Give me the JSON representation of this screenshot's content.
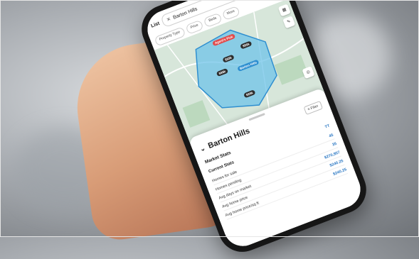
{
  "app": {
    "search": {
      "list_label": "List",
      "query": "Barton Hills"
    },
    "filters": [
      "Property Type",
      "Price",
      "Beds",
      "More"
    ],
    "map": {
      "markers": [
        {
          "label": "Agent's Pick",
          "style": "red"
        },
        {
          "label": "$$$k",
          "style": "dark"
        },
        {
          "label": "$$$k",
          "style": "dark"
        },
        {
          "label": "$$$k",
          "style": "dark"
        },
        {
          "label": "Barton Hills",
          "style": "blue"
        },
        {
          "label": "$$$k",
          "style": "dark"
        }
      ]
    },
    "sheet": {
      "title": "Barton Hills",
      "filter_label": "Filter",
      "market_stats_heading": "Market Stats",
      "current_stats_heading": "Current Stats",
      "current_stats_value": "TT",
      "rows": [
        {
          "label": "Homes for sale",
          "value": "45"
        },
        {
          "label": "Homes pending",
          "value": "35"
        },
        {
          "label": "Avg days on market",
          "value": "$270,957"
        },
        {
          "label": "Avg home price",
          "value": "$240.25"
        },
        {
          "label": "Avg home price/sq ft",
          "value": "$240.25"
        }
      ]
    }
  },
  "colors": {
    "map_land": "#cfe2d4",
    "map_area": "#6fc3e8",
    "accent": "#2b78c4"
  }
}
